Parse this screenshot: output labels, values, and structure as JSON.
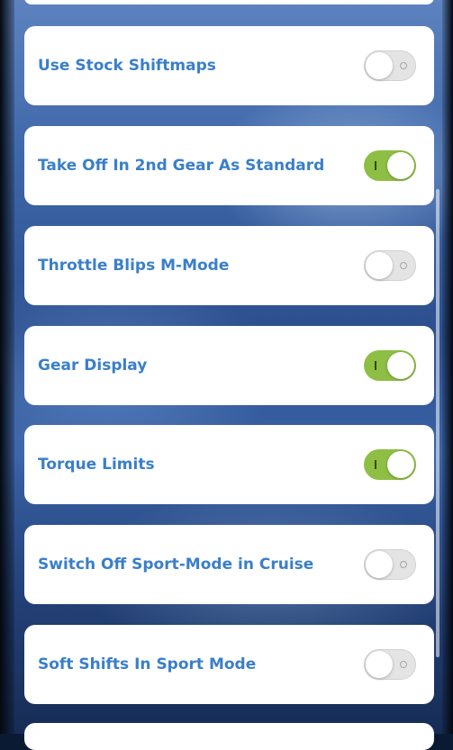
{
  "settings": [
    {
      "label": "Use Stock Shiftmaps",
      "enabled": false
    },
    {
      "label": "Take Off In 2nd Gear As Standard",
      "enabled": true
    },
    {
      "label": "Throttle Blips M-Mode",
      "enabled": false
    },
    {
      "label": "Gear Display",
      "enabled": true
    },
    {
      "label": "Torque Limits",
      "enabled": true
    },
    {
      "label": "Switch Off Sport-Mode in Cruise",
      "enabled": false
    },
    {
      "label": "Soft Shifts In Sport Mode",
      "enabled": false
    }
  ],
  "colors": {
    "label_text": "#3a7fc9",
    "toggle_on": "#8ebe44",
    "toggle_off": "#e4e4e4",
    "card_background": "#ffffff"
  }
}
